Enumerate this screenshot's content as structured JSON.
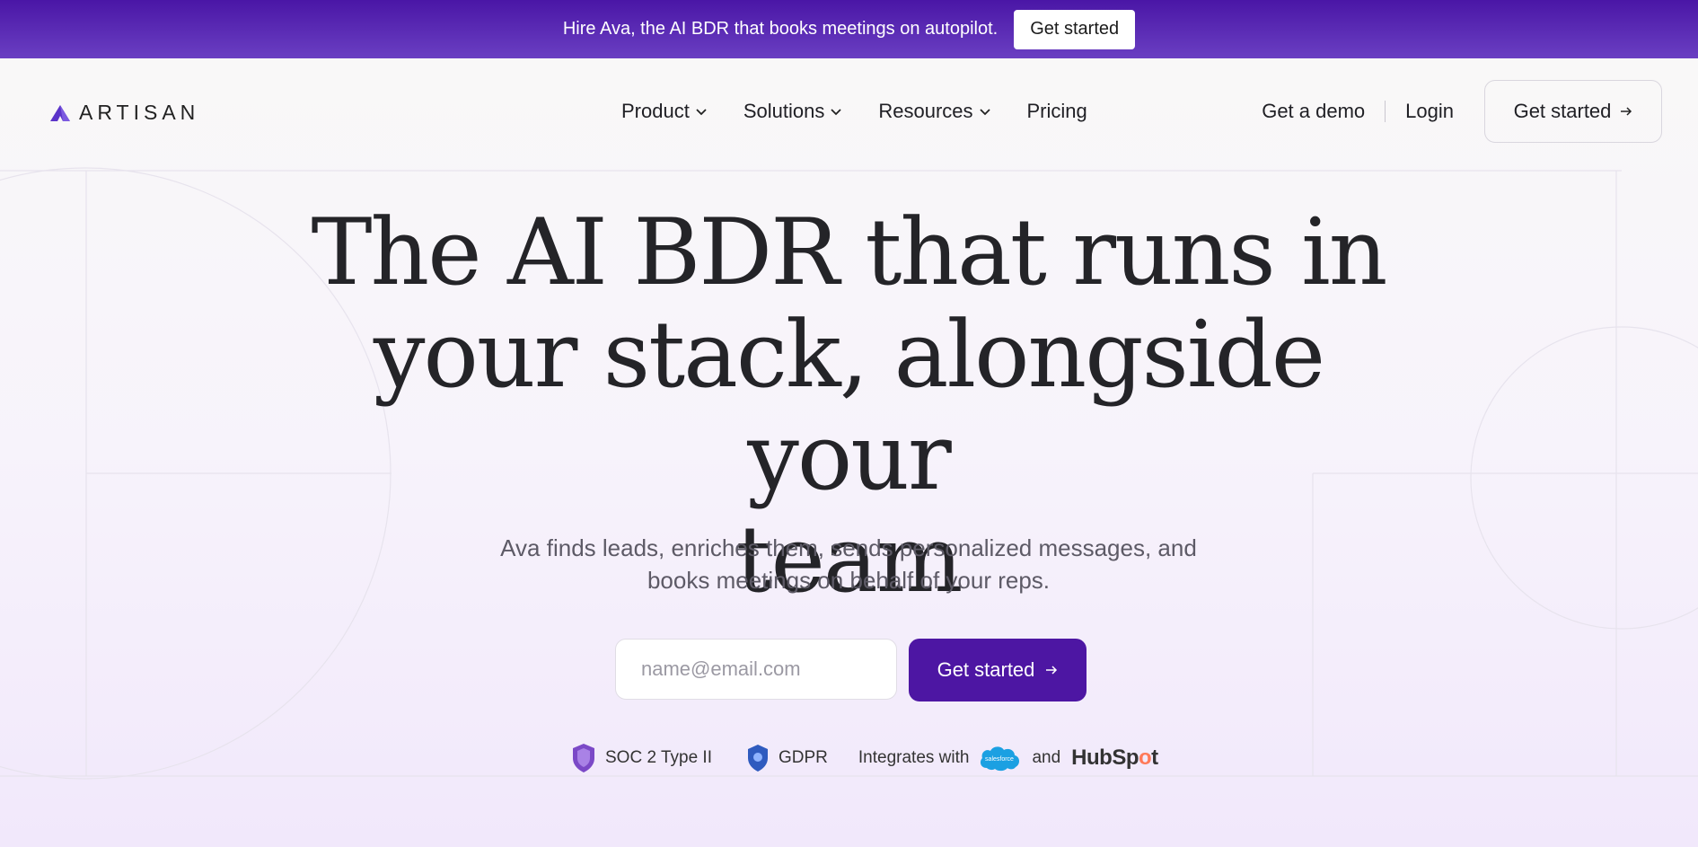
{
  "announcement": {
    "text": "Hire Ava, the AI BDR that books meetings on autopilot.",
    "button_label": "Get started"
  },
  "brand": {
    "logo_text": "ARTISAN",
    "accent_color": "#4d16a3"
  },
  "nav": {
    "items": [
      {
        "label": "Product",
        "dropdown": true
      },
      {
        "label": "Solutions",
        "dropdown": true
      },
      {
        "label": "Resources",
        "dropdown": true
      },
      {
        "label": "Pricing",
        "dropdown": false
      }
    ],
    "demo_label": "Get a demo",
    "login_label": "Login",
    "cta_label": "Get started",
    "cta_icon": "arrow-right-icon"
  },
  "hero": {
    "title_lines": [
      "The AI BDR that runs in",
      "your stack, alongside your",
      "team"
    ],
    "subtitle_lines": [
      "Ava finds leads, enriches them, sends personalized messages, and",
      "books meetings on behalf of your reps."
    ],
    "email_placeholder": "name@email.com",
    "cta_label": "Get started",
    "cta_icon": "arrow-right-icon"
  },
  "trust": {
    "soc2": "SOC 2 Type II",
    "gdpr": "GDPR",
    "integrates": "Integrates with",
    "salesforce": "salesforce",
    "and": "and",
    "hubspot_prefix": "HubSp",
    "hubspot_o": "o",
    "hubspot_suffix": "t"
  }
}
